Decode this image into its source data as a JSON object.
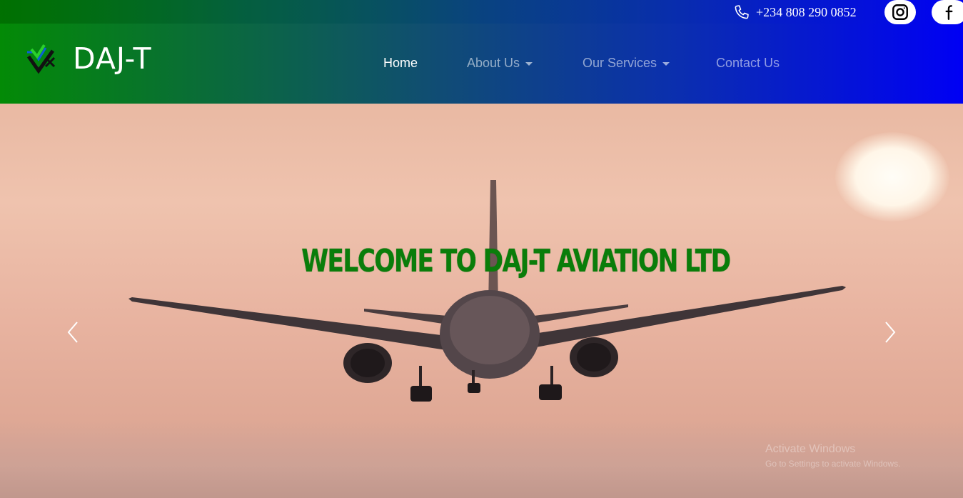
{
  "topbar": {
    "phone": "+234 808 290 0852",
    "icons": [
      "phone-icon",
      "instagram-icon",
      "facebook-icon"
    ]
  },
  "brand": {
    "name": "DAJ-T",
    "logo": "daj-t-logo"
  },
  "nav": {
    "items": [
      {
        "label": "Home",
        "active": true,
        "dropdown": false
      },
      {
        "label": "About Us",
        "active": false,
        "dropdown": true
      },
      {
        "label": "Our Services",
        "active": false,
        "dropdown": true
      },
      {
        "label": "Contact Us",
        "active": false,
        "dropdown": false
      }
    ]
  },
  "hero": {
    "title": "WELCOME TO DAJ-T AVIATION LTD",
    "prev_icon": "chevron-left-icon",
    "next_icon": "chevron-right-icon"
  },
  "watermark": {
    "title": "Activate Windows",
    "subtitle": "Go to Settings to activate Windows."
  },
  "colors": {
    "gradient_start": "#038a06",
    "gradient_end": "#0000f4",
    "title_green": "#0a7d0a"
  }
}
